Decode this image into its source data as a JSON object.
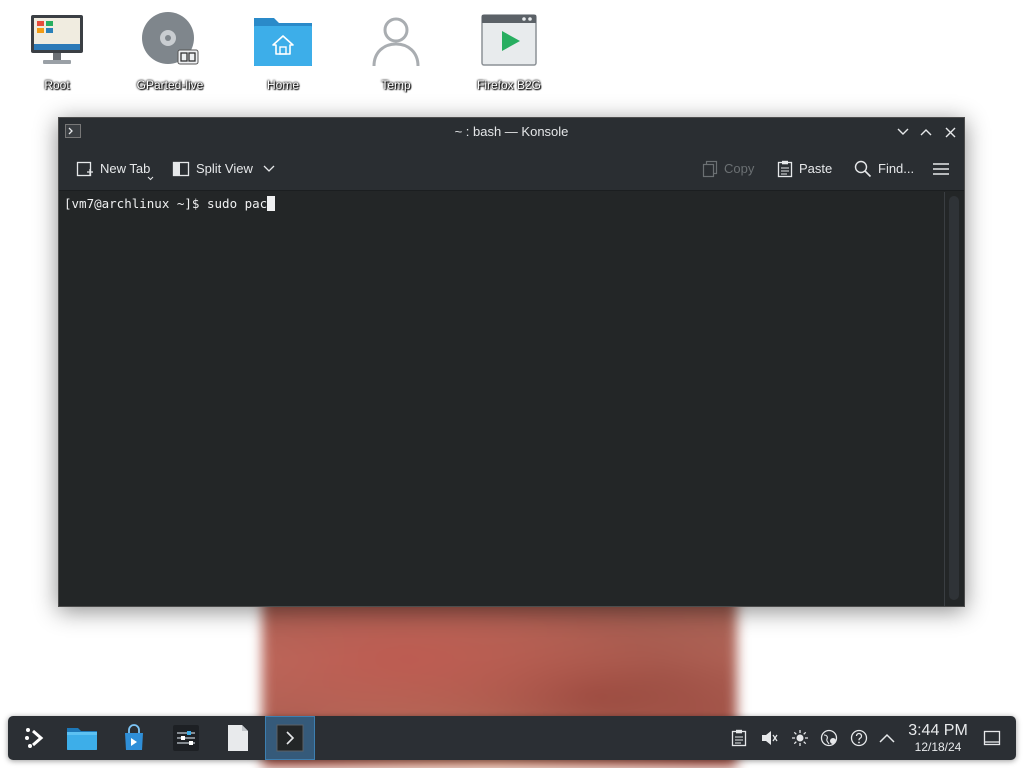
{
  "desktop": {
    "icons": [
      {
        "label": "Root",
        "icon": "monitor-icon"
      },
      {
        "label": "GParted-live",
        "icon": "disc-icon"
      },
      {
        "label": "Home",
        "icon": "home-folder-icon"
      },
      {
        "label": "Temp",
        "icon": "user-icon"
      },
      {
        "label": "Firefox B2G",
        "icon": "app-window-icon"
      }
    ]
  },
  "window": {
    "title": "~ : bash — Konsole",
    "toolbar": {
      "new_tab": "New Tab",
      "split_view": "Split View",
      "copy": "Copy",
      "paste": "Paste",
      "find": "Find..."
    },
    "terminal": {
      "prompt": "[vm7@archlinux ~]$ ",
      "command": "sudo pac"
    }
  },
  "taskbar": {
    "apps": [
      {
        "name": "application-launcher",
        "icon": "launcher-icon"
      },
      {
        "name": "file-manager",
        "icon": "folder-icon"
      },
      {
        "name": "software-store",
        "icon": "shopping-bag-icon"
      },
      {
        "name": "system-settings",
        "icon": "sliders-icon"
      },
      {
        "name": "text-document",
        "icon": "document-icon"
      },
      {
        "name": "konsole",
        "icon": "terminal-icon"
      }
    ],
    "clock": {
      "time": "3:44 PM",
      "date": "12/18/24"
    }
  },
  "colors": {
    "window_bg": "#232627",
    "titlebar_bg": "#2a2e32",
    "accent": "#3daee9",
    "taskbar_bg": "#2b2f34"
  }
}
